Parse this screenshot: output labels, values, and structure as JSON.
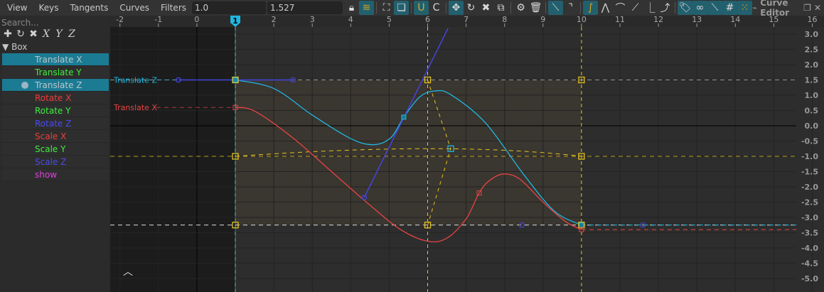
{
  "menu": [
    "View",
    "Keys",
    "Tangents",
    "Curves",
    "Filters"
  ],
  "fields": {
    "time": "1.0",
    "value": "1.527"
  },
  "toolbar_icons": [
    "lock-icon",
    "wave-snap-icon",
    "frame-all-icon",
    "frame-selected-icon",
    "magnet-icon",
    "snap-c-icon",
    "move-icon",
    "rotate-icon",
    "scale-icon",
    "copy-icon",
    "settings-icon",
    "delete-icon",
    "linear-key-icon",
    "broken-tangent-icon",
    "auto-tangent-icon",
    "peak-icon",
    "smooth-icon",
    "bezier-icon",
    "step-icon",
    "ease-icon",
    "tag-icon",
    "infinity-icon",
    "spline-icon",
    "grid-icon",
    "dots-icon"
  ],
  "title": "Curve Editor",
  "search_placeholder": "Search...",
  "box": "Box",
  "channels": [
    {
      "label": "Translate X",
      "color": "#b9c6cb",
      "selected": true
    },
    {
      "label": "Translate Y",
      "color": "#3ef03e",
      "selected": false
    },
    {
      "label": "Translate Z",
      "color": "#b9c6cb",
      "selected": true,
      "dot": true
    },
    {
      "label": "Rotate X",
      "color": "#f03c3c",
      "selected": false
    },
    {
      "label": "Rotate Y",
      "color": "#3ef03e",
      "selected": false
    },
    {
      "label": "Rotate Z",
      "color": "#4a4af0",
      "selected": false
    },
    {
      "label": "Scale X",
      "color": "#f03c3c",
      "selected": false
    },
    {
      "label": "Scale Y",
      "color": "#3ef03e",
      "selected": false
    },
    {
      "label": "Scale Z",
      "color": "#4a4af0",
      "selected": false
    },
    {
      "label": "show",
      "color": "#e040e0",
      "selected": false
    }
  ],
  "current_frame": "1",
  "graph": {
    "x_ticks": [
      -2,
      -1,
      0,
      1,
      2,
      3,
      4,
      5,
      6,
      7,
      8,
      9,
      10,
      11,
      12,
      13,
      14,
      15,
      16
    ],
    "y_ticks": [
      "3.0",
      "2.5",
      "2.0",
      "1.5",
      "1.0",
      "0.5",
      "0.0",
      "-0.5",
      "-1.0",
      "-1.5",
      "-2.0",
      "-2.5",
      "-3.0",
      "-3.5",
      "-4.0",
      "-4.5",
      "-5.0"
    ],
    "colors": {
      "translate_z": "#1fb6e0",
      "translate_x": "#e84444",
      "selection": "#e6c21e",
      "tangent": "#4444e0"
    },
    "curves": [
      {
        "name": "Translate Z",
        "color": "#1fb6e0",
        "pre": 1.5,
        "post": -3.25,
        "points": [
          [
            1,
            1.5
          ],
          [
            2,
            1.22
          ],
          [
            3,
            0.35
          ],
          [
            4,
            -0.42
          ],
          [
            4.6,
            -0.62
          ],
          [
            5.05,
            -0.38
          ],
          [
            5.38,
            0.28
          ],
          [
            5.8,
            0.95
          ],
          [
            6.2,
            1.14
          ],
          [
            6.6,
            1.02
          ],
          [
            7.5,
            0.1
          ],
          [
            8.5,
            -1.6
          ],
          [
            9.3,
            -2.8
          ],
          [
            10,
            -3.25
          ]
        ]
      },
      {
        "name": "Translate X",
        "color": "#e84444",
        "pre": 0.6,
        "post": -3.4,
        "points": [
          [
            1,
            0.6
          ],
          [
            1.5,
            0.48
          ],
          [
            2.5,
            -0.4
          ],
          [
            3.5,
            -1.5
          ],
          [
            4.5,
            -2.6
          ],
          [
            5.3,
            -3.4
          ],
          [
            6,
            -3.78
          ],
          [
            6.5,
            -3.68
          ],
          [
            7,
            -3.05
          ],
          [
            7.34,
            -2.2
          ],
          [
            7.6,
            -1.8
          ],
          [
            7.97,
            -1.58
          ],
          [
            8.4,
            -1.75
          ],
          [
            9,
            -2.5
          ],
          [
            9.6,
            -3.15
          ],
          [
            10,
            -3.4
          ]
        ]
      }
    ],
    "keys": {
      "cyan": [
        [
          1,
          1.5
        ],
        [
          5.38,
          0.28
        ],
        [
          10,
          -3.25
        ]
      ],
      "red": [
        [
          1,
          0.6
        ],
        [
          7.34,
          -2.2
        ],
        [
          10,
          -3.4
        ]
      ]
    },
    "handles": [
      [
        -0.48,
        1.5
      ],
      [
        2.5,
        1.5
      ],
      [
        8.45,
        -3.25
      ],
      [
        11.6,
        -3.25
      ],
      [
        4.35,
        -2.35
      ]
    ],
    "tangent_line": [
      [
        4.35,
        -2.35
      ],
      [
        6.53,
        3.19
      ]
    ],
    "selection_keys": [
      [
        1,
        1.5
      ],
      [
        6,
        1.5
      ],
      [
        10,
        1.5
      ],
      [
        1,
        -1
      ],
      [
        10,
        -1
      ],
      [
        1,
        -3.25
      ],
      [
        6,
        -3.25
      ],
      [
        10,
        -3.25
      ]
    ],
    "selection_pivot": [
      6.6,
      -0.75
    ],
    "selection_box": {
      "t": [
        1,
        10
      ],
      "v": [
        1.5,
        -3.25
      ]
    }
  }
}
